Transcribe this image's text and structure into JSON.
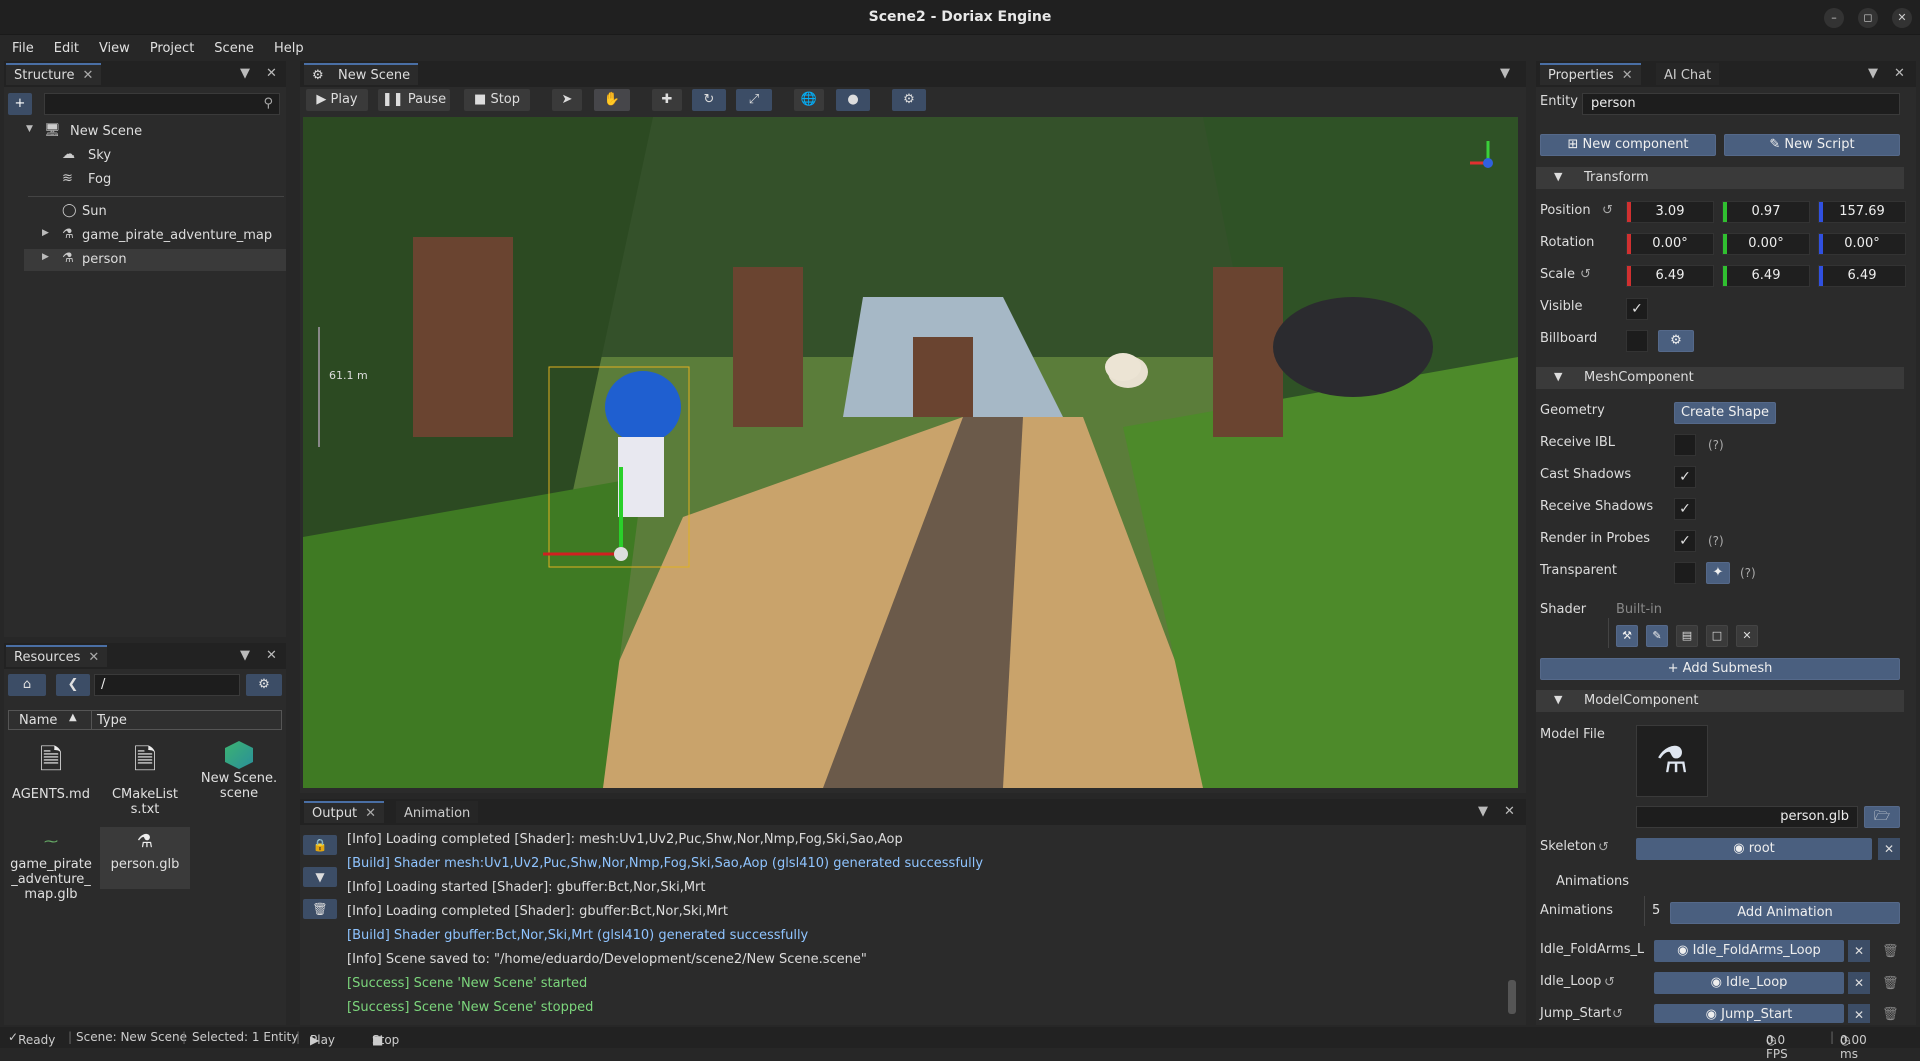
{
  "window": {
    "title": "Scene2 - Doriax Engine"
  },
  "menu": [
    "File",
    "Edit",
    "View",
    "Project",
    "Scene",
    "Help"
  ],
  "structure": {
    "tab_label": "Structure",
    "tree": [
      {
        "label": "New Scene"
      },
      {
        "label": "Sky"
      },
      {
        "label": "Fog"
      },
      {
        "label": "Sun"
      },
      {
        "label": "game_pirate_adventure_map"
      },
      {
        "label": "person"
      }
    ]
  },
  "resources": {
    "tab_label": "Resources",
    "path": "/",
    "col_name": "Name",
    "col_type": "Type",
    "files": [
      {
        "name": "AGENTS.md"
      },
      {
        "name": "CMakeLists.txt"
      },
      {
        "name": "New Scene.scene"
      },
      {
        "name": "game_pirate_adventure_map.glb"
      },
      {
        "name": "person.glb"
      }
    ]
  },
  "viewport": {
    "tab_label": "New Scene",
    "play": "Play",
    "pause": "Pause",
    "stop": "Stop",
    "distance_label": "61.1 m"
  },
  "output": {
    "tab_output": "Output",
    "tab_animation": "Animation",
    "lines": [
      {
        "text": "[Info] Loading completed [Shader]: mesh:Uv1,Uv2,Puc,Shw,Nor,Nmp,Fog,Ski,Sao,Aop",
        "kind": "info"
      },
      {
        "text": "[Build] Shader mesh:Uv1,Uv2,Puc,Shw,Nor,Nmp,Fog,Ski,Sao,Aop (glsl410) generated successfully",
        "kind": "build"
      },
      {
        "text": "[Info] Loading started [Shader]: gbuffer:Bct,Nor,Ski,Mrt",
        "kind": "info"
      },
      {
        "text": "[Info] Loading completed [Shader]: gbuffer:Bct,Nor,Ski,Mrt",
        "kind": "info"
      },
      {
        "text": "[Build] Shader gbuffer:Bct,Nor,Ski,Mrt (glsl410) generated successfully",
        "kind": "build"
      },
      {
        "text": "[Info] Scene saved to: \"/home/eduardo/Development/scene2/New Scene.scene\"",
        "kind": "info"
      },
      {
        "text": "[Success] Scene 'New Scene' started",
        "kind": "ok"
      },
      {
        "text": "[Success] Scene 'New Scene' stopped",
        "kind": "ok"
      }
    ]
  },
  "properties": {
    "tab_properties": "Properties",
    "tab_ai": "AI Chat",
    "entity_label": "Entity",
    "entity_value": "person",
    "new_component": "New component",
    "new_script": "New Script",
    "transform": {
      "title": "Transform",
      "position_label": "Position",
      "position": [
        "3.09",
        "0.97",
        "157.69"
      ],
      "rotation_label": "Rotation",
      "rotation": [
        "0.00°",
        "0.00°",
        "0.00°"
      ],
      "scale_label": "Scale",
      "scale": [
        "6.49",
        "6.49",
        "6.49"
      ],
      "visible_label": "Visible",
      "billboard_label": "Billboard"
    },
    "mesh": {
      "title": "MeshComponent",
      "geometry_label": "Geometry",
      "create_shape": "Create Shape",
      "receive_ibl": "Receive IBL",
      "cast_shadows": "Cast Shadows",
      "receive_shadows": "Receive Shadows",
      "render_in_probes": "Render in Probes",
      "transparent": "Transparent",
      "shader_label": "Shader",
      "shader_value": "Built-in",
      "add_submesh": "+ Add Submesh",
      "help": "(?)"
    },
    "model": {
      "title": "ModelComponent",
      "model_file_label": "Model File",
      "model_file": "person.glb",
      "skeleton_label": "Skeleton",
      "skeleton_value": "root",
      "animations_header": "Animations",
      "animations_label": "Animations",
      "animations_count": "5",
      "add_animation": "Add Animation",
      "anims": [
        {
          "label": "Idle_FoldArms_Lo",
          "value": "Idle_FoldArms_Loop"
        },
        {
          "label": "Idle_Loop",
          "value": "Idle_Loop"
        },
        {
          "label": "Jump_Start",
          "value": "Jump_Start"
        }
      ]
    }
  },
  "status": {
    "ready": "Ready",
    "scene": "Scene: New Scene",
    "selected": "Selected: 1 Entity",
    "play": "Play",
    "stop": "Stop",
    "fps": "0.0 FPS",
    "ms": "0.00 ms"
  }
}
